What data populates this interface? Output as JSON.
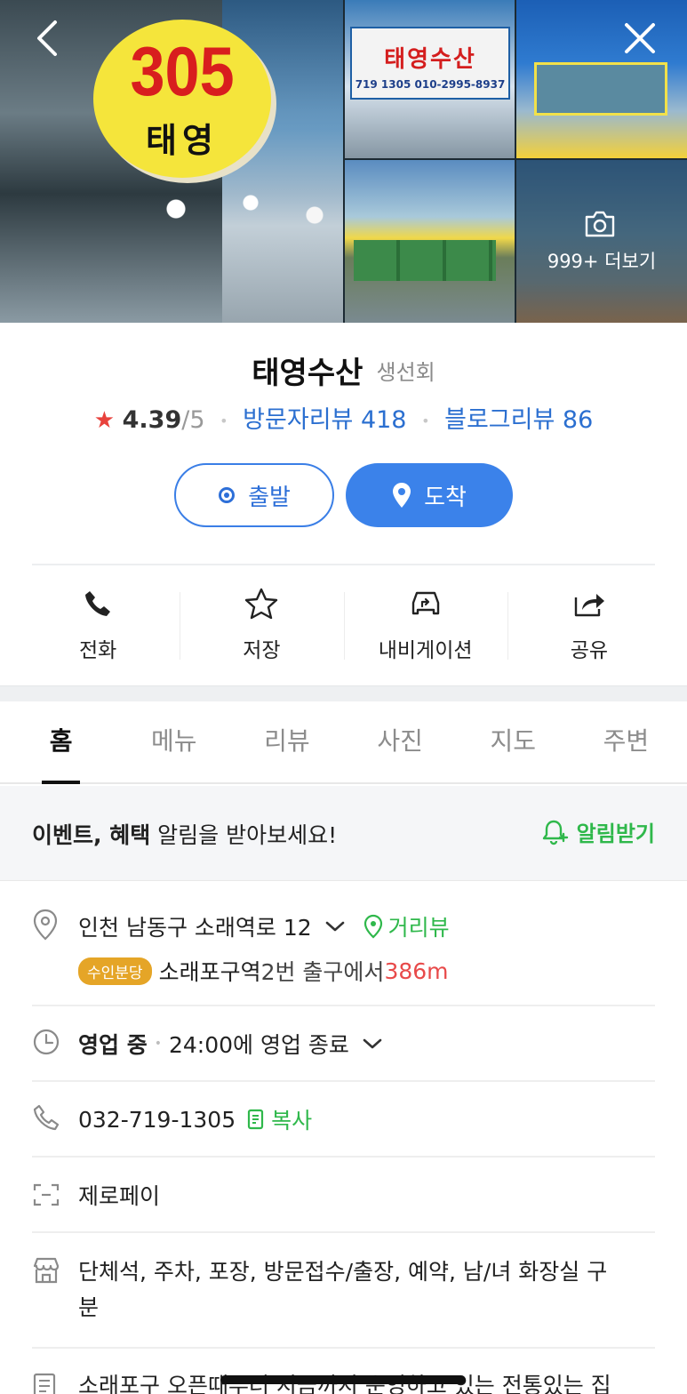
{
  "header": {
    "sign_number": "305",
    "sign_name": "태영",
    "board_name": "태영수산",
    "board_phone": "719 1305  010-2995-8937",
    "more_photos": "999+ 더보기"
  },
  "place": {
    "name": "태영수산",
    "category": "생선회",
    "rating": "4.39",
    "rating_max": "/5",
    "visitor_reviews": "방문자리뷰 418",
    "blog_reviews": "블로그리뷰 86"
  },
  "route": {
    "start_label": "출발",
    "arrive_label": "도착"
  },
  "actions": [
    {
      "label": "전화",
      "icon": "phone-icon"
    },
    {
      "label": "저장",
      "icon": "star-icon"
    },
    {
      "label": "내비게이션",
      "icon": "car-icon"
    },
    {
      "label": "공유",
      "icon": "share-icon"
    }
  ],
  "tabs": [
    "홈",
    "메뉴",
    "리뷰",
    "사진",
    "지도",
    "주변"
  ],
  "notice": {
    "text_bold": "이벤트, 혜택",
    "text_rest": " 알림을 받아보세요!",
    "button": "알림받기"
  },
  "info": {
    "address": "인천 남동구 소래역로 12",
    "street_view": "거리뷰",
    "subway_line": "수인분당",
    "station": "소래포구역",
    "exit_text": " 2번 출구에서 ",
    "distance": "386m",
    "open_status": "영업 중",
    "hours": "24:00에 영업 종료",
    "phone": "032-719-1305",
    "copy": "복사",
    "payment": "제로페이",
    "facilities_1": "단체석, 주차, 포장, 방문접수/출장, 예약, 남/녀 화장실 구",
    "facilities_2": "분",
    "description": "소래포구 오픈때부터 지금까지 운영하고 있는 전통있는 집"
  },
  "colors": {
    "accent_blue": "#3b82ea",
    "link_blue": "#2b6fd0",
    "green": "#2fb84b",
    "star_red": "#e8423c",
    "distance_red": "#e84a4a",
    "badge_orange": "#e5a527"
  }
}
